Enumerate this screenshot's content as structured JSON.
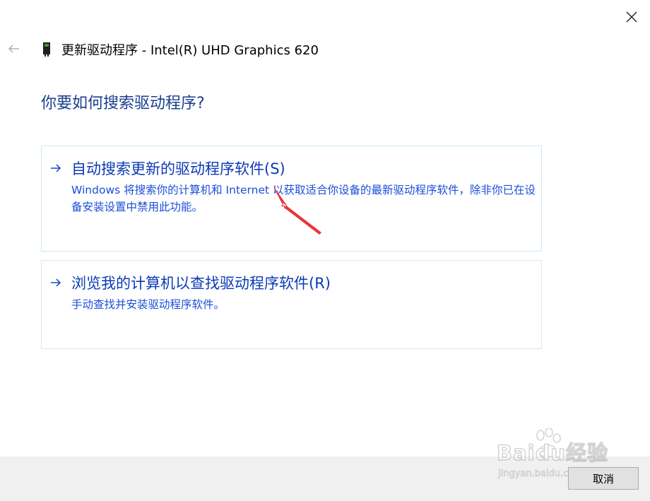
{
  "window": {
    "title": "更新驱动程序 - Intel(R) UHD Graphics 620",
    "icons": {
      "close": "close-icon",
      "back": "back-arrow-icon",
      "device": "display-adapter-icon"
    }
  },
  "page": {
    "heading": "你要如何搜索驱动程序?"
  },
  "options": [
    {
      "title": "自动搜索更新的驱动程序软件(S)",
      "description": "Windows 将搜索你的计算机和 Internet 以获取适合你设备的最新驱动程序软件，除非你已在设备安装设置中禁用此功能。",
      "icon": "right-arrow-icon"
    },
    {
      "title": "浏览我的计算机以查找驱动程序软件(R)",
      "description": "手动查找并安装驱动程序软件。",
      "icon": "right-arrow-icon"
    }
  ],
  "footer": {
    "cancel_label": "取消"
  },
  "watermark": {
    "logo_text": "Baidu经验",
    "url_text": "jingyan.baidu.com"
  },
  "colors": {
    "heading": "#1a3e8e",
    "option_title": "#0b3bb5",
    "option_desc": "#1b4fd9",
    "annotation_arrow": "#e8353b",
    "footer_bg": "#f0f0f0"
  }
}
